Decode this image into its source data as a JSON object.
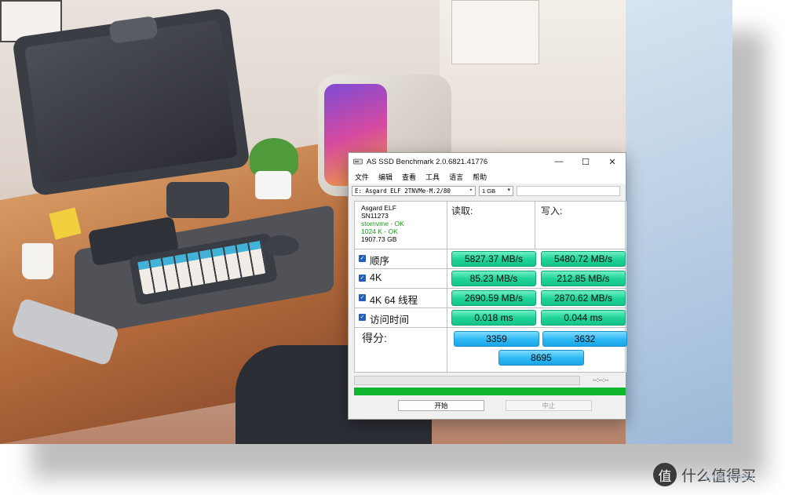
{
  "window": {
    "title": "AS SSD Benchmark 2.0.6821.41776",
    "buttons": {
      "minimize": "—",
      "maximize": "☐",
      "close": "✕"
    }
  },
  "menu": [
    "文件",
    "编辑",
    "查看",
    "工具",
    "语言",
    "帮助"
  ],
  "toolbar": {
    "drive": "E: Asgard ELF 2TNVMe-M.2/80",
    "size": "1 GB"
  },
  "info": {
    "model": "Asgard ELF",
    "serial": "SN11273",
    "driver": "stornvme - OK",
    "alignment": "1024 K - OK",
    "capacity": "1907.73 GB"
  },
  "headers": {
    "read": "读取:",
    "write": "写入:"
  },
  "tests": [
    {
      "name": "顺序",
      "read": "5827.37 MB/s",
      "write": "5480.72 MB/s"
    },
    {
      "name": "4K",
      "read": "85.23 MB/s",
      "write": "212.85 MB/s"
    },
    {
      "name": "4K 64 线程",
      "read": "2690.59 MB/s",
      "write": "2870.62 MB/s"
    },
    {
      "name": "访问时间",
      "read": "0.018 ms",
      "write": "0.044 ms"
    }
  ],
  "score": {
    "label": "得分:",
    "read": "3359",
    "write": "3632",
    "total": "8695"
  },
  "status": {
    "time": "--:--:--",
    "progress": 1.0
  },
  "actions": {
    "start": "开始",
    "stop": "中止"
  },
  "watermark": {
    "logo": "值",
    "text": "什么值得买",
    "sub": "SMYZ.NET"
  },
  "colors": {
    "result_green": "#22d49a",
    "score_blue": "#2cb7f2",
    "progress_green": "#0fb62e"
  }
}
